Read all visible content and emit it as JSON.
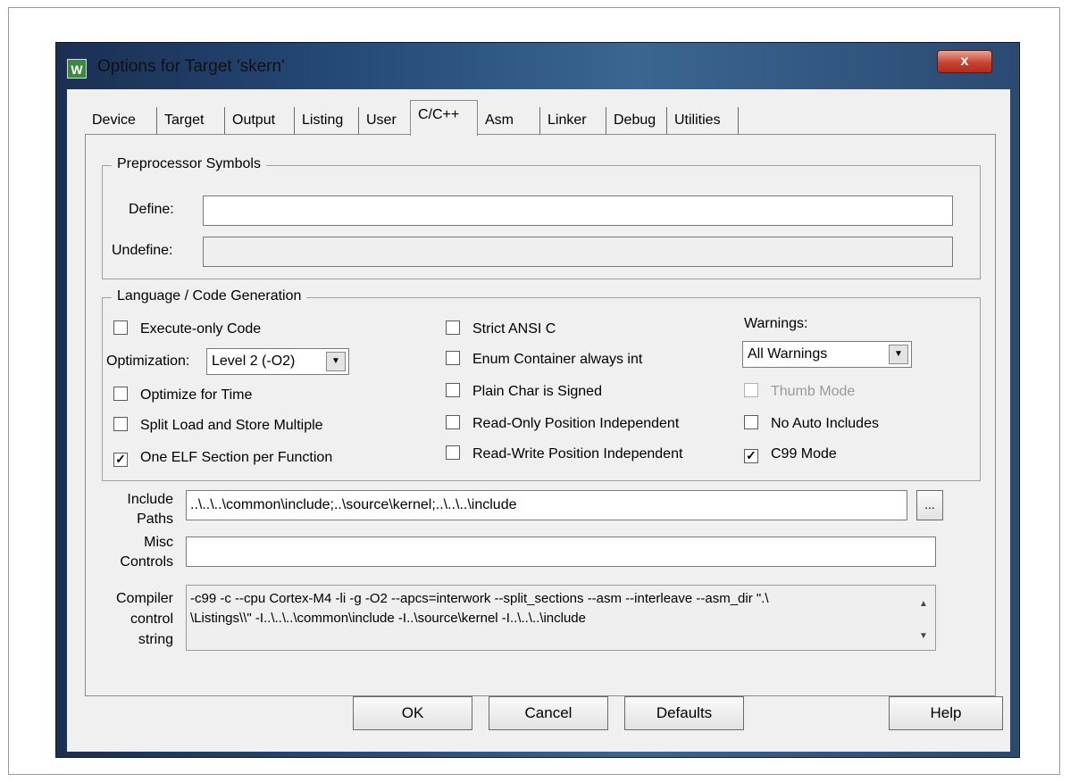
{
  "window": {
    "title": "Options for Target 'skern'",
    "icon": "W",
    "close_glyph": "x"
  },
  "tabs": [
    {
      "label": "Device"
    },
    {
      "label": "Target"
    },
    {
      "label": "Output"
    },
    {
      "label": "Listing"
    },
    {
      "label": "User"
    },
    {
      "label": "C/C++"
    },
    {
      "label": "Asm"
    },
    {
      "label": "Linker"
    },
    {
      "label": "Debug"
    },
    {
      "label": "Utilities"
    }
  ],
  "active_tab": "C/C++",
  "preprocessor": {
    "group_label": "Preprocessor Symbols",
    "define_label": "Define:",
    "define_value": "",
    "undefine_label": "Undefine:",
    "undefine_value": ""
  },
  "codegen": {
    "group_label": "Language / Code Generation",
    "execute_only": {
      "label": "Execute-only Code",
      "checked": false
    },
    "optimization_label": "Optimization:",
    "optimization_value": "Level 2 (-O2)",
    "optimize_time": {
      "label": "Optimize for Time",
      "checked": false
    },
    "split_load": {
      "label": "Split Load and Store Multiple",
      "checked": false
    },
    "one_elf": {
      "label": "One ELF Section per Function",
      "checked": true
    },
    "strict_ansi": {
      "label": "Strict ANSI C",
      "checked": false
    },
    "enum_int": {
      "label": "Enum Container always int",
      "checked": false
    },
    "plain_char": {
      "label": "Plain Char is Signed",
      "checked": false
    },
    "ro_pi": {
      "label": "Read-Only Position Independent",
      "checked": false
    },
    "rw_pi": {
      "label": "Read-Write Position Independent",
      "checked": false
    },
    "warnings_label": "Warnings:",
    "warnings_value": "All Warnings",
    "thumb_mode": {
      "label": "Thumb Mode",
      "checked": false,
      "disabled": true
    },
    "no_auto_includes": {
      "label": "No Auto Includes",
      "checked": false
    },
    "c99_mode": {
      "label": "C99 Mode",
      "checked": true
    }
  },
  "include_paths": {
    "label_line1": "Include",
    "label_line2": "Paths",
    "value": "..\\..\\..\\common\\include;..\\source\\kernel;..\\..\\..\\include",
    "browse": "..."
  },
  "misc_controls": {
    "label_line1": "Misc",
    "label_line2": "Controls",
    "value": ""
  },
  "compiler_string": {
    "label_line1": "Compiler",
    "label_line2": "control",
    "label_line3": "string",
    "line1": "-c99 -c --cpu Cortex-M4 -li -g -O2 --apcs=interwork --split_sections --asm --interleave --asm_dir \".\\",
    "line2": "\\Listings\\\\\" -I..\\..\\..\\common\\include -I..\\source\\kernel -I..\\..\\..\\include"
  },
  "buttons": {
    "ok": "OK",
    "cancel": "Cancel",
    "defaults": "Defaults",
    "help": "Help"
  },
  "check_glyph": "✓"
}
